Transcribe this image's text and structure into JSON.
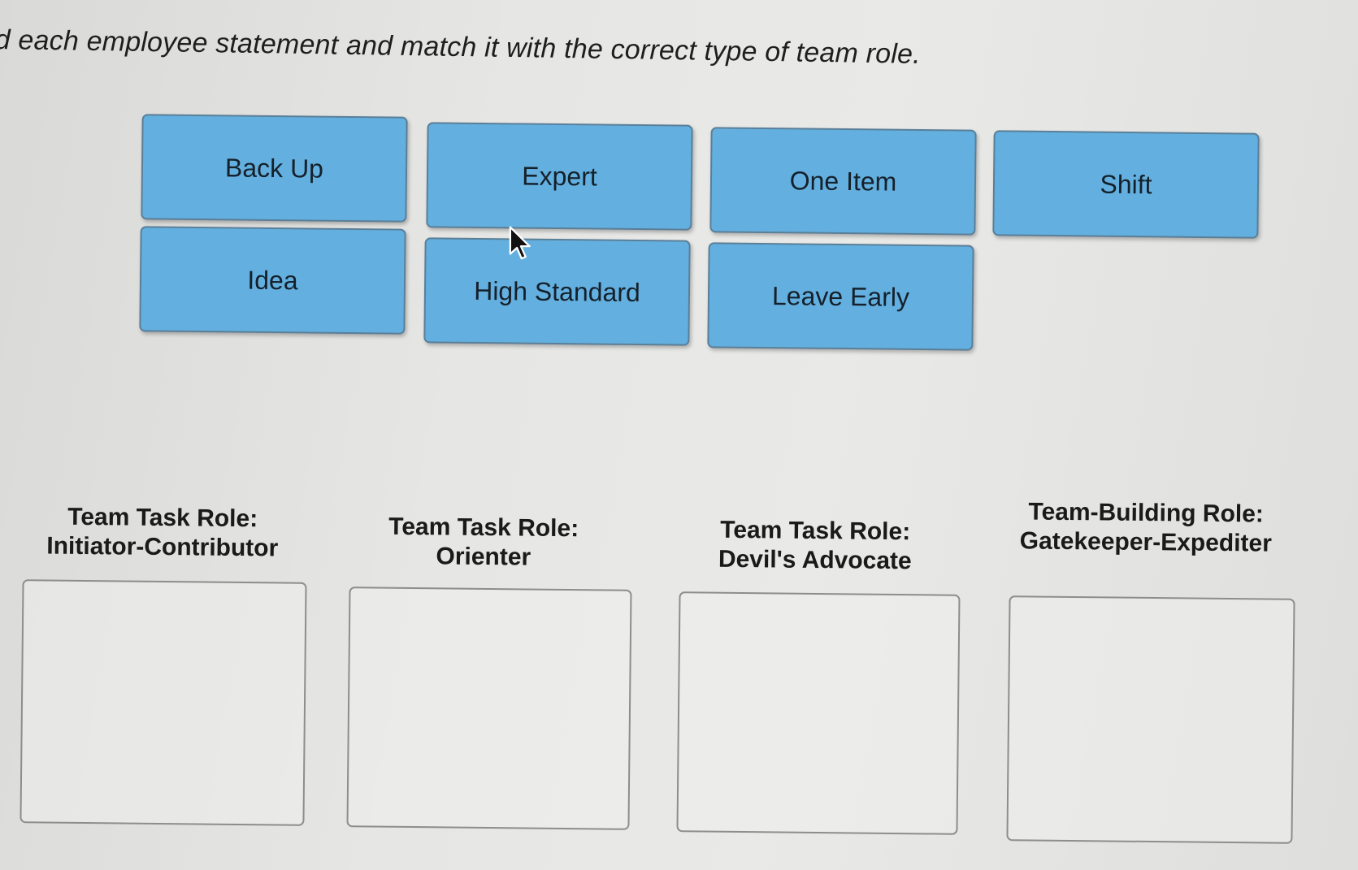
{
  "instruction": "d each employee statement and match it with the correct type of team role.",
  "tiles": [
    {
      "label": "Back Up"
    },
    {
      "label": "Expert"
    },
    {
      "label": "One Item"
    },
    {
      "label": "Shift"
    },
    {
      "label": "Idea"
    },
    {
      "label": "High Standard"
    },
    {
      "label": "Leave Early"
    }
  ],
  "zones": [
    {
      "line1": "Team Task Role:",
      "line2": "Initiator-Contributor"
    },
    {
      "line1": "Team Task Role:",
      "line2": "Orienter"
    },
    {
      "line1": "Team Task Role:",
      "line2": "Devil's Advocate"
    },
    {
      "line1": "Team-Building Role:",
      "line2": "Gatekeeper-Expediter"
    }
  ],
  "colors": {
    "tile_fill": "#63b0e0",
    "tile_border": "#5a7f99",
    "dropzone_border": "#8d8d8b"
  },
  "icons": {
    "mouse_cursor": "arrow-pointer-icon"
  }
}
